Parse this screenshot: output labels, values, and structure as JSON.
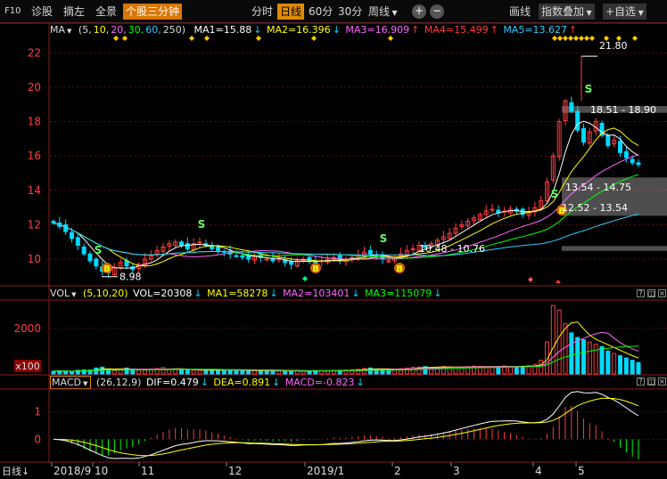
{
  "toolbar": {
    "f10": "F10",
    "diagnose": "诊股",
    "pick": "摘左",
    "panorama": "全景",
    "three_min": "个股三分钟",
    "intraday": "分时",
    "daily": "日线",
    "m60": "60分",
    "m30": "30分",
    "weekly": "周线",
    "draw": "画线",
    "index_overlay": "指数叠加",
    "self_pick": "+自选"
  },
  "ma_legend": {
    "name": "MA",
    "params_prefix": "(5,",
    "p10": "10,",
    "p20": "20,",
    "p30": "30,",
    "p60": "60,",
    "p250": "250)",
    "ma1": "MA1=15.88",
    "ma2": "MA2=16.396",
    "ma3": "MA3=16.909",
    "ma4": "MA4=15.499",
    "ma5": "MA5=13.627"
  },
  "vol_legend": {
    "name": "VOL",
    "params": "(5,10,20)",
    "vol": "VOL=20308",
    "ma1": "MA1=58278",
    "ma2": "MA2=103401",
    "ma3": "MA3=115079"
  },
  "macd_legend": {
    "name": "MACD",
    "params": "(26,12,9)",
    "dif": "DIF=0.479",
    "dea": "DEA=0.891",
    "macd": "MACD=-0.823"
  },
  "annotations": {
    "high": "21.80",
    "low": "8.98",
    "zone1": "18.51 - 18.90",
    "zone2": "13.54 - 14.75",
    "zone3": "12.52 - 13.54",
    "zone4": "10.48 - 10.76",
    "unit": "x100",
    "buy": "B",
    "sell": "S",
    "period_label": "日线"
  },
  "colors": {
    "up": "#ff3b3b",
    "down": "#00d8ff",
    "ma5": "#ffffff",
    "ma10": "#ffff00",
    "ma20": "#ff66ff",
    "ma30": "#00ff00",
    "ma60": "#33ccff",
    "grid": "#8b1a1a",
    "axis_text": "#ff4040"
  },
  "chart_data": [
    {
      "type": "candlestick",
      "ylabel_ticks": [
        "10",
        "12",
        "14",
        "16",
        "18",
        "20",
        "22"
      ],
      "ylim": [
        8.5,
        23
      ],
      "x_ticks": [
        "2018/9",
        "10",
        "11",
        "12",
        "2019/1",
        "2",
        "3",
        "4",
        "5"
      ],
      "close": [
        12.1,
        11.9,
        11.6,
        11.2,
        10.8,
        10.3,
        9.9,
        9.6,
        9.3,
        9.2,
        9.5,
        9.8,
        9.6,
        9.4,
        9.7,
        10.0,
        10.2,
        10.5,
        10.7,
        10.9,
        11.0,
        10.8,
        10.6,
        10.9,
        11.0,
        10.8,
        10.6,
        10.5,
        10.4,
        10.3,
        10.2,
        10.1,
        10.0,
        10.2,
        10.1,
        10.0,
        9.9,
        10.0,
        9.8,
        9.7,
        9.9,
        10.0,
        9.9,
        9.8,
        9.9,
        10.0,
        10.1,
        9.9,
        10.0,
        10.1,
        10.2,
        10.4,
        10.3,
        10.2,
        10.0,
        9.9,
        10.1,
        10.3,
        10.5,
        10.6,
        10.8,
        10.7,
        10.9,
        11.1,
        11.3,
        11.5,
        11.8,
        12.0,
        12.2,
        12.4,
        12.6,
        12.8,
        12.9,
        12.7,
        12.8,
        12.9,
        12.8,
        12.6,
        12.7,
        13.0,
        13.4,
        14.5,
        16.0,
        18.0,
        19.2,
        18.6,
        17.5,
        16.8,
        17.4,
        18.0,
        17.2,
        16.6,
        16.9,
        16.2,
        15.9,
        15.6,
        15.5
      ],
      "ma5": [
        15.88
      ],
      "series": [
        {
          "name": "MA1",
          "last": 15.88
        },
        {
          "name": "MA2",
          "last": 16.396
        },
        {
          "name": "MA3",
          "last": 16.909
        },
        {
          "name": "MA4",
          "last": 15.499
        },
        {
          "name": "MA5",
          "last": 13.627
        }
      ],
      "high": 21.8,
      "low": 8.98
    },
    {
      "type": "bar",
      "title": "VOL",
      "ylabel_ticks": [
        "2000"
      ],
      "unit": "x100",
      "values": [
        120,
        140,
        110,
        100,
        160,
        180,
        170,
        260,
        300,
        200,
        150,
        180,
        260,
        220,
        170,
        160,
        190,
        240,
        280,
        210,
        190,
        200,
        180,
        170,
        160,
        150,
        170,
        190,
        180,
        160,
        150,
        140,
        130,
        140,
        150,
        160,
        140,
        130,
        120,
        140,
        130,
        120,
        130,
        150,
        140,
        130,
        150,
        160,
        170,
        180,
        200,
        240,
        260,
        220,
        190,
        180,
        200,
        230,
        260,
        290,
        300,
        320,
        280,
        300,
        330,
        310,
        290,
        300,
        320,
        340,
        330,
        310,
        300,
        320,
        350,
        330,
        310,
        340,
        360,
        400,
        600,
        1400,
        3000,
        2800,
        2200,
        1800,
        1600,
        1500,
        1400,
        1300,
        1200,
        1000,
        900,
        800,
        700,
        600,
        500
      ],
      "series": [
        {
          "name": "VOL",
          "last": 20308
        },
        {
          "name": "MA1",
          "last": 58278
        },
        {
          "name": "MA2",
          "last": 103401
        },
        {
          "name": "MA3",
          "last": 115079
        }
      ]
    },
    {
      "type": "bar",
      "title": "MACD",
      "ylabel_ticks": [
        "1",
        "0"
      ],
      "ylim": [
        -0.8,
        1.8
      ],
      "series": [
        {
          "name": "DIF",
          "last": 0.479
        },
        {
          "name": "DEA",
          "last": 0.891
        },
        {
          "name": "MACD",
          "last": -0.823
        }
      ]
    }
  ]
}
